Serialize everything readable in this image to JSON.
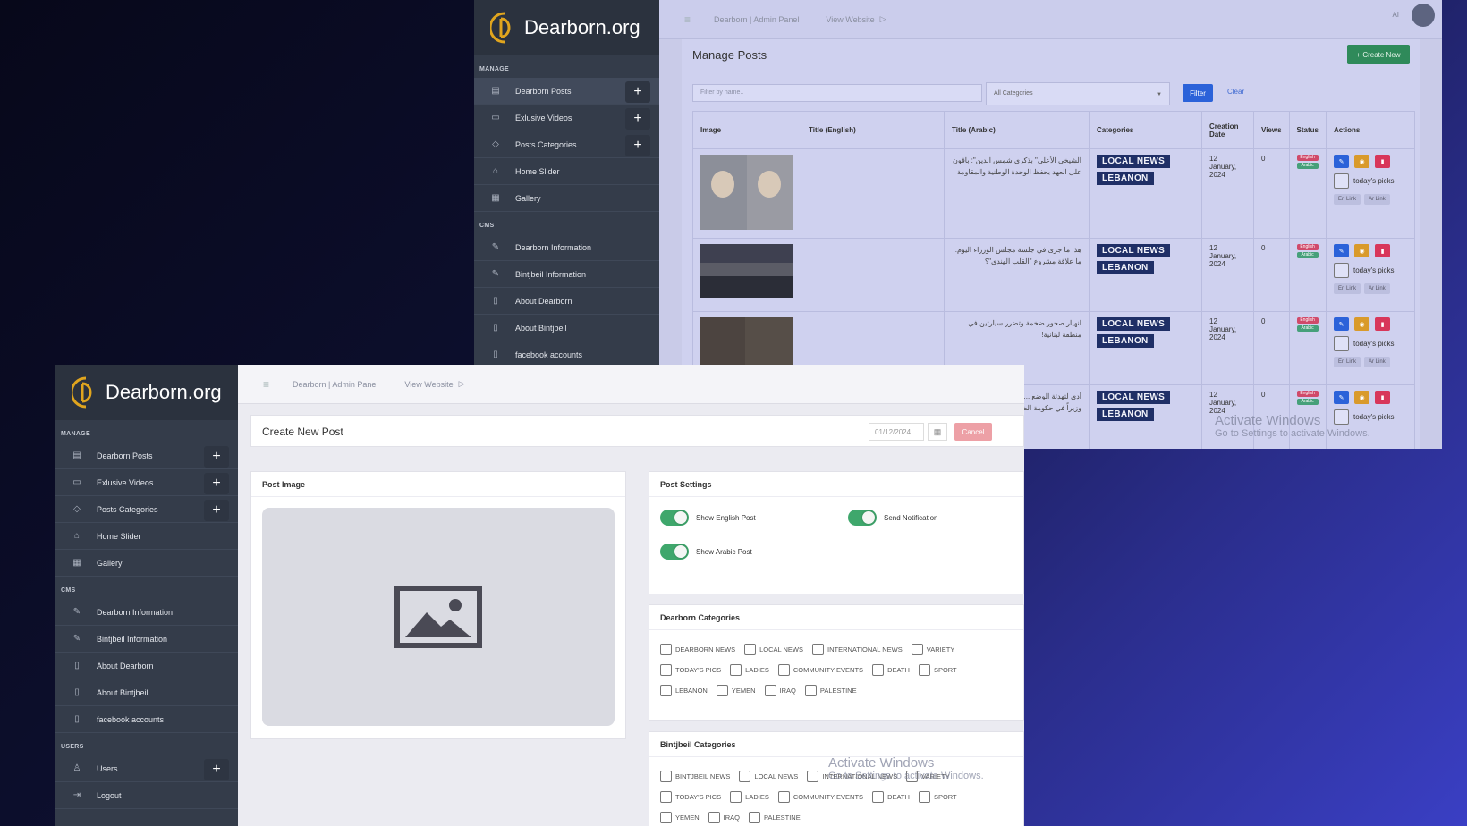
{
  "brand": "Dearborn.org",
  "sidebar": {
    "sections": {
      "manage": "MANAGE",
      "cms": "CMS",
      "users": "USERS"
    },
    "manage_items": [
      {
        "label": "Dearborn Posts",
        "icon": "newspaper-icon"
      },
      {
        "label": "Exlusive Videos",
        "icon": "video-icon"
      },
      {
        "label": "Posts Categories",
        "icon": "tag-icon"
      },
      {
        "label": "Home Slider",
        "icon": "home-icon"
      },
      {
        "label": "Gallery",
        "icon": "grid-icon"
      }
    ],
    "cms_items": [
      {
        "label": "Dearborn Information",
        "icon": "pencil-icon"
      },
      {
        "label": "Bintjbeil Information",
        "icon": "pencil-icon"
      },
      {
        "label": "About Dearborn",
        "icon": "info-icon"
      },
      {
        "label": "About Bintjbeil",
        "icon": "info-icon"
      },
      {
        "label": "facebook accounts",
        "icon": "info-icon"
      }
    ],
    "users_items": [
      {
        "label": "Users",
        "icon": "user-icon"
      },
      {
        "label": "Logout",
        "icon": "logout-icon"
      }
    ],
    "plus": "+"
  },
  "topbar": {
    "menu_icon": "≡",
    "breadcrumb": "Dearborn | Admin Panel",
    "view_website": "View Website",
    "user_initials": "AI"
  },
  "manage_posts": {
    "title": "Manage Posts",
    "create_new": "+ Create New",
    "filter_placeholder": "Filter by name..",
    "category_select": "All Categories",
    "filter_btn": "Filter",
    "clear_btn": "Clear",
    "columns": [
      "Image",
      "Title (English)",
      "Title (Arabic)",
      "Categories",
      "Creation Date",
      "Views",
      "Status",
      "Actions"
    ],
    "status_en": "English",
    "status_ar": "Arabic",
    "todays_picks": "today's picks",
    "en_link": "En Link",
    "ar_link": "Ar Link",
    "rows": [
      {
        "title_en": "",
        "title_ar": "الشيخي الأعلى\" بذكرى شمس الدين\": باقون على العهد بحفظ الوحدة الوطنية والمقاومة",
        "categories": [
          "LOCAL NEWS",
          "LEBANON"
        ],
        "date": "12 January, 2024",
        "views": "0"
      },
      {
        "title_en": "",
        "title_ar": "هذا ما جرى في جلسة مجلس الوزراء اليوم.. ما علاقة مشروع \"القلب الهندي\"؟",
        "categories": [
          "LOCAL NEWS",
          "LEBANON"
        ],
        "date": "12 January, 2024",
        "views": "0"
      },
      {
        "title_en": "",
        "title_ar": "انهيار صخور ضخمة وتضرر سيارتين في منطقة لبنانية!",
        "categories": [
          "LOCAL NEWS",
          "LEBANON"
        ],
        "date": "12 January, 2024",
        "views": "0"
      },
      {
        "title_en": "",
        "title_ar": "أدى لتهدئة الوضع ... وزير الخارجية التقى وزيراً في حكومة الظل البريطانية",
        "categories": [
          "LOCAL NEWS",
          "LEBANON"
        ],
        "date": "12 January, 2024",
        "views": "0"
      }
    ]
  },
  "create_post": {
    "title": "Create New Post",
    "date_placeholder": "01/12/2024",
    "cancel": "Cancel",
    "post_image": "Post Image",
    "post_settings": "Post Settings",
    "toggles": {
      "show_english": "Show English Post",
      "send_notification": "Send Notification",
      "show_arabic": "Show Arabic Post"
    },
    "dearborn_categories_title": "Dearborn Categories",
    "dearborn_categories": [
      "DEARBORN NEWS",
      "LOCAL NEWS",
      "INTERNATIONAL NEWS",
      "VARIETY",
      "TODAY'S PICS",
      "LADIES",
      "COMMUNITY EVENTS",
      "DEATH",
      "SPORT",
      "LEBANON",
      "YEMEN",
      "IRAQ",
      "PALESTINE"
    ],
    "bintjbeil_categories_title": "Bintjbeil Categories",
    "bintjbeil_categories": [
      "BINTJBEIL NEWS",
      "LOCAL NEWS",
      "INTERNATIONAL NEWS",
      "VARIETY",
      "TODAY'S PICS",
      "LADIES",
      "COMMUNITY EVENTS",
      "DEATH",
      "SPORT",
      "YEMEN",
      "IRAQ",
      "PALESTINE"
    ]
  },
  "watermark": {
    "title": "Activate Windows",
    "subtitle": "Go to Settings to activate Windows."
  }
}
